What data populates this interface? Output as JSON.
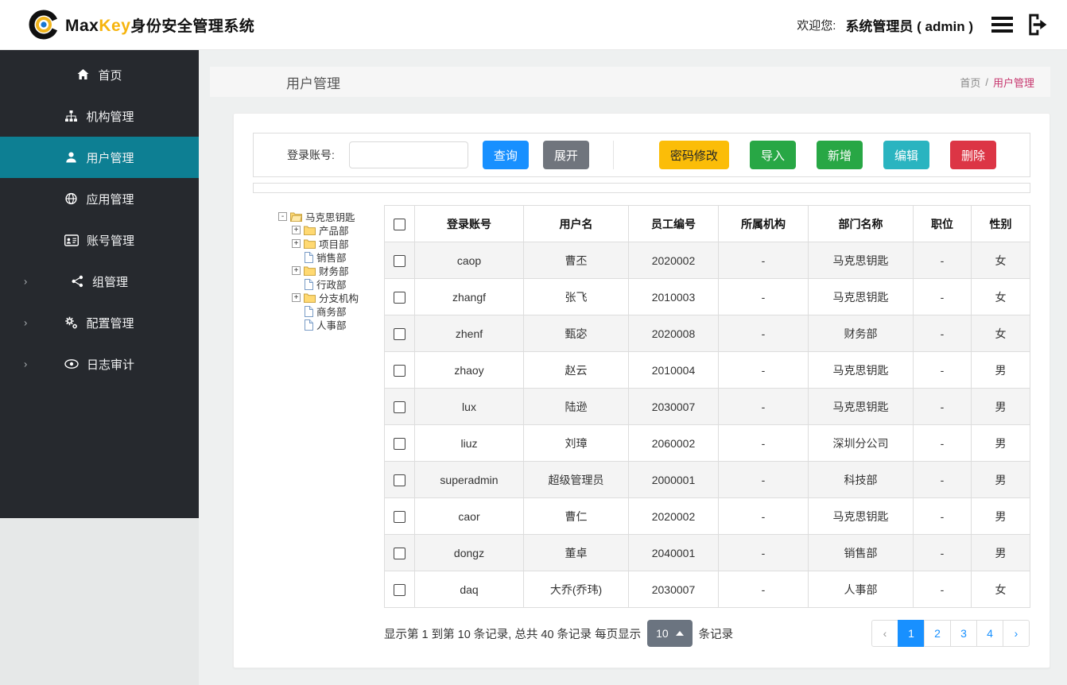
{
  "header": {
    "brand_max": "Max",
    "brand_key": "Key",
    "brand_suffix": "身份安全管理系统",
    "welcome_label": "欢迎您:",
    "welcome_user": "系统管理员 ( admin )"
  },
  "sidebar": {
    "items": [
      {
        "label": "首页",
        "icon": "home-icon",
        "active": false,
        "expandable": false
      },
      {
        "label": "机构管理",
        "icon": "sitemap-icon",
        "active": false,
        "expandable": false
      },
      {
        "label": "用户管理",
        "icon": "user-icon",
        "active": true,
        "expandable": false
      },
      {
        "label": "应用管理",
        "icon": "globe-icon",
        "active": false,
        "expandable": false
      },
      {
        "label": "账号管理",
        "icon": "id-card-icon",
        "active": false,
        "expandable": false
      },
      {
        "label": "组管理",
        "icon": "share-icon",
        "active": false,
        "expandable": true
      },
      {
        "label": "配置管理",
        "icon": "gears-icon",
        "active": false,
        "expandable": true
      },
      {
        "label": "日志审计",
        "icon": "eye-icon",
        "active": false,
        "expandable": true
      }
    ],
    "chevron": "›"
  },
  "page": {
    "title": "用户管理",
    "breadcrumb": {
      "home": "首页",
      "sep": "/",
      "current": "用户管理"
    }
  },
  "toolbar": {
    "search_label": "登录账号:",
    "search_value": "",
    "query": "查询",
    "expand": "展开",
    "password": "密码修改",
    "import": "导入",
    "add": "新增",
    "edit": "编辑",
    "delete": "删除"
  },
  "tree": {
    "root": "马克思钥匙",
    "root_expander": "-",
    "nodes": [
      {
        "label": "产品部",
        "type": "folder",
        "expander": "+"
      },
      {
        "label": "项目部",
        "type": "folder",
        "expander": "+"
      },
      {
        "label": "销售部",
        "type": "file",
        "expander": ""
      },
      {
        "label": "财务部",
        "type": "folder",
        "expander": "+"
      },
      {
        "label": "行政部",
        "type": "file",
        "expander": ""
      },
      {
        "label": "分支机构",
        "type": "folder",
        "expander": "+"
      },
      {
        "label": "商务部",
        "type": "file",
        "expander": ""
      },
      {
        "label": "人事部",
        "type": "file",
        "expander": ""
      }
    ]
  },
  "table": {
    "columns": [
      "登录账号",
      "用户名",
      "员工编号",
      "所属机构",
      "部门名称",
      "职位",
      "性别"
    ],
    "rows": [
      [
        "caop",
        "曹丕",
        "2020002",
        "-",
        "马克思钥匙",
        "-",
        "女"
      ],
      [
        "zhangf",
        "张飞",
        "2010003",
        "-",
        "马克思钥匙",
        "-",
        "女"
      ],
      [
        "zhenf",
        "甄宓",
        "2020008",
        "-",
        "财务部",
        "-",
        "女"
      ],
      [
        "zhaoy",
        "赵云",
        "2010004",
        "-",
        "马克思钥匙",
        "-",
        "男"
      ],
      [
        "lux",
        "陆逊",
        "2030007",
        "-",
        "马克思钥匙",
        "-",
        "男"
      ],
      [
        "liuz",
        "刘璋",
        "2060002",
        "-",
        "深圳分公司",
        "-",
        "男"
      ],
      [
        "superadmin",
        "超级管理员",
        "2000001",
        "-",
        "科技部",
        "-",
        "男"
      ],
      [
        "caor",
        "曹仁",
        "2020002",
        "-",
        "马克思钥匙",
        "-",
        "男"
      ],
      [
        "dongz",
        "董卓",
        "2040001",
        "-",
        "销售部",
        "-",
        "男"
      ],
      [
        "daq",
        "大乔(乔玮)",
        "2030007",
        "-",
        "人事部",
        "-",
        "女"
      ]
    ]
  },
  "pagination": {
    "summary_prefix": "显示第 1 到第 10 条记录, 总共 40 条记录  每页显示",
    "page_size": "10",
    "summary_suffix": "条记录",
    "prev": "‹",
    "next": "›",
    "pages": [
      "1",
      "2",
      "3",
      "4"
    ],
    "active_page": "1"
  },
  "icons": {
    "header": [
      "menu-icon",
      "logout-icon"
    ],
    "sidebar": [
      "home",
      "sitemap",
      "user",
      "globe",
      "id-card",
      "share",
      "gears",
      "eye"
    ],
    "tree": [
      "folder",
      "file"
    ]
  },
  "colors": {
    "sidebar_bg": "#26292e",
    "active_item": "#0d7f93",
    "primary_blue": "#1890ff",
    "gray_button": "#70757d",
    "yellow_button": "#fbbd08",
    "green_button": "#28a745",
    "teal_button": "#2ab4c0",
    "red_button": "#dc3545",
    "breadcrumb_current": "#c7366e",
    "brand_key": "#f6b40e"
  }
}
